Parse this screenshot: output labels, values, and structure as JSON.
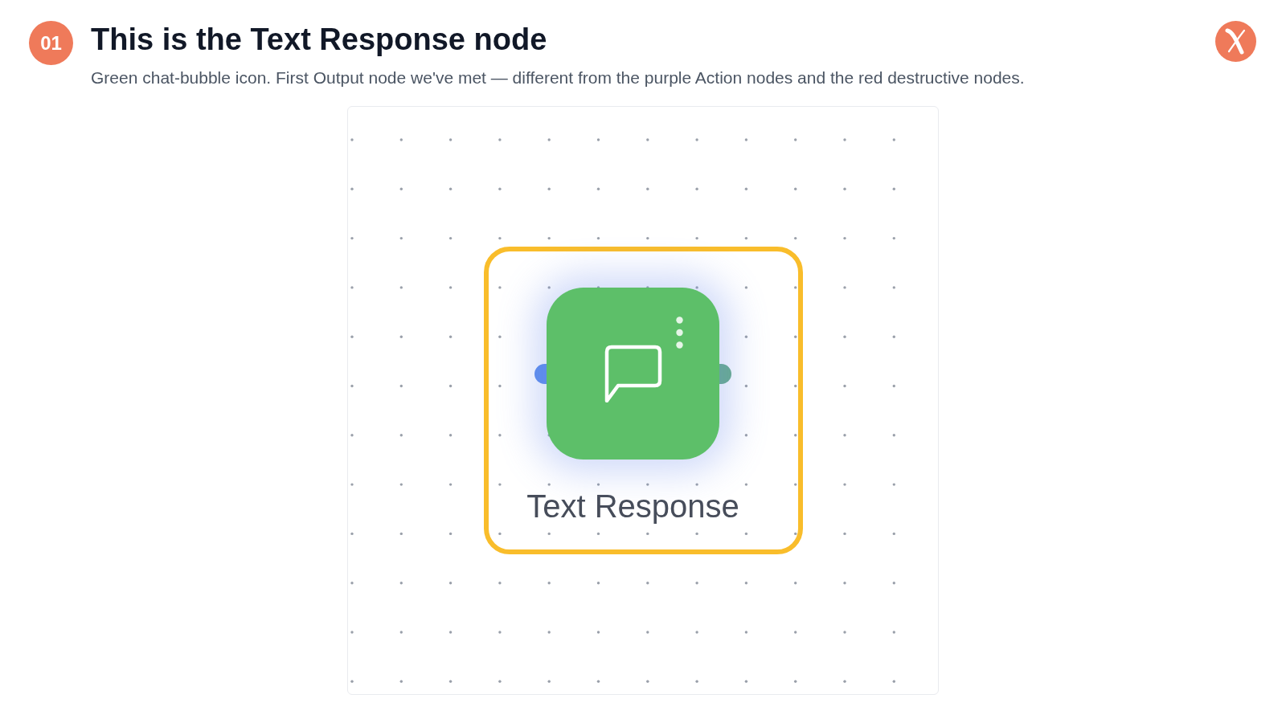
{
  "header": {
    "step_badge": "01",
    "title": "This is the Text Response node",
    "subtitle": "Green chat-bubble icon. First Output node we've met — different from the purple Action nodes and the red destructive nodes."
  },
  "canvas": {
    "node": {
      "label": "Text Response",
      "highlighted": true
    }
  }
}
